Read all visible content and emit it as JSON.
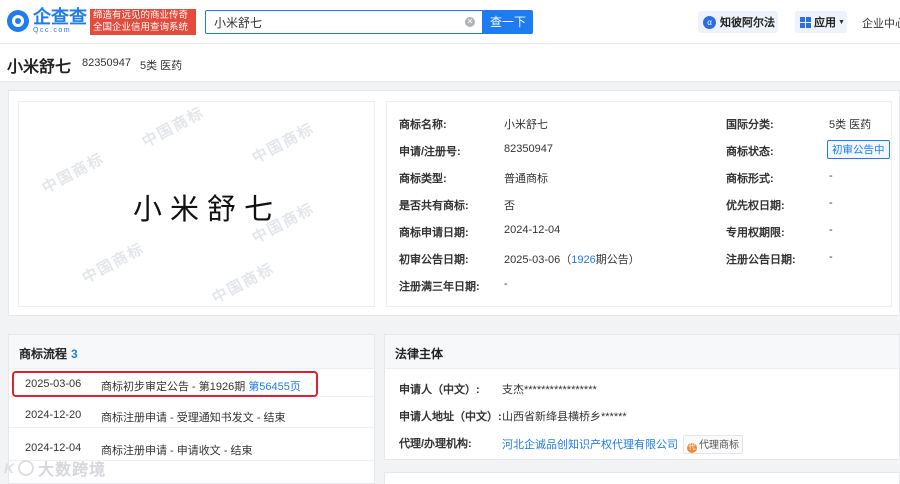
{
  "header": {
    "logo_cn": "企查查",
    "logo_en": "Qcc.com",
    "slogan_line1": "缔造有远见的商业传奇",
    "slogan_line2": "全国企业信用查询系统",
    "search_value": "小米舒七",
    "search_button": "查一下",
    "zhibi_label": "知彼阿尔法",
    "apps_label": "应用",
    "enterprise_center": "企业中心"
  },
  "trademark": {
    "name": "小米舒七",
    "reg_no": "82350947",
    "class_short": "5类 医药",
    "image_text": "小米舒七",
    "watermark": "中国商标"
  },
  "details": {
    "left": [
      {
        "label": "商标名称:",
        "value": "小米舒七"
      },
      {
        "label": "申请/注册号:",
        "value": "82350947"
      },
      {
        "label": "商标类型:",
        "value": "普通商标"
      },
      {
        "label": "是否共有商标:",
        "value": "否"
      },
      {
        "label": "商标申请日期:",
        "value": "2024-12-04"
      },
      {
        "label": "初审公告日期:",
        "value_prefix": "2025-03-06（",
        "value_link": "1926",
        "value_suffix": "期公告）"
      },
      {
        "label": "注册满三年日期:",
        "value": "-"
      }
    ],
    "right": [
      {
        "label": "国际分类:",
        "value": "5类 医药"
      },
      {
        "label": "商标状态:",
        "badge": "初审公告中"
      },
      {
        "label": "商标形式:",
        "value": "-"
      },
      {
        "label": "优先权日期:",
        "value": "-"
      },
      {
        "label": "专用权期限:",
        "value": "-"
      },
      {
        "label": "注册公告日期:",
        "value": "-"
      }
    ]
  },
  "flow": {
    "title": "商标流程",
    "count": "3",
    "items": [
      {
        "date": "2025-03-06",
        "desc": "商标初步审定公告 - 第1926期",
        "link": "第56455页"
      },
      {
        "date": "2024-12-20",
        "desc": "商标注册申请 - 受理通知书发文 - 结束"
      },
      {
        "date": "2024-12-04",
        "desc": "商标注册申请 - 申请收文 - 结束"
      }
    ]
  },
  "legal": {
    "title": "法律主体",
    "applicant_label": "申请人（中文）:",
    "applicant_value": "支杰*****************",
    "address_label": "申请人地址（中文）:",
    "address_value": "山西省新绛县横桥乡******",
    "agent_label": "代理/办理机构:",
    "agent_value": "河北企诚品创知识产权代理有限公司",
    "agent_badge": "代理商标"
  },
  "watermark_footer": "大数跨境",
  "colors": {
    "accent": "#1f7bf0",
    "highlight": "#e0202c",
    "slogan_bg": "#e54b3c"
  }
}
